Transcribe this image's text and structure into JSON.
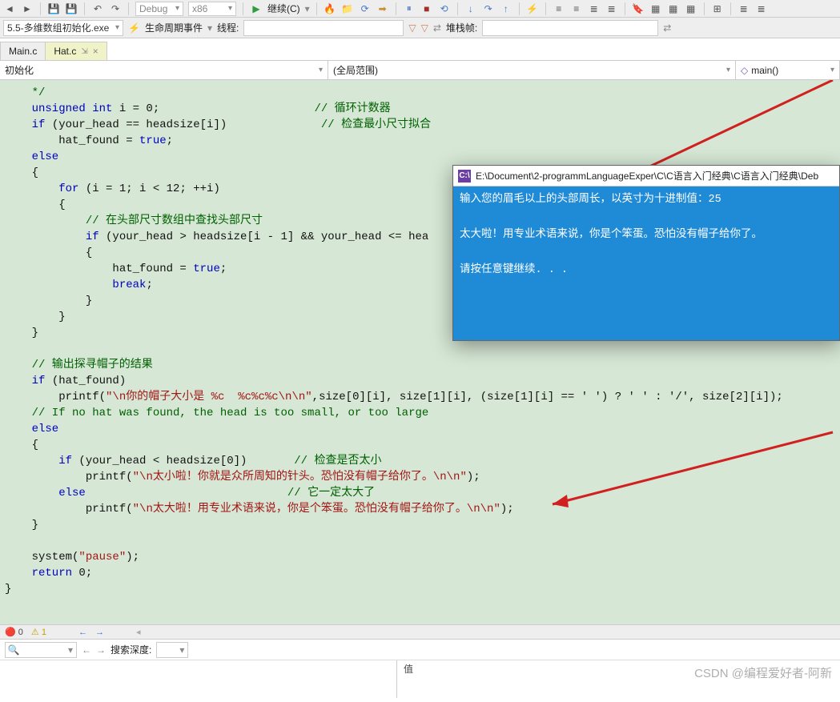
{
  "toolbar": {
    "config": "Debug",
    "platform": "x86",
    "continue_label": "继续(C)"
  },
  "secondbar": {
    "process_label": "5.5-多维数组初始化.exe",
    "lifecycle_label": "生命周期事件",
    "thread_label": "线程:",
    "stackframe_label": "堆栈帧:"
  },
  "tabs": {
    "t0": "Main.c",
    "t1": "Hat.c"
  },
  "scopes": {
    "left": "初始化",
    "mid": "(全局范围)",
    "right": "main()"
  },
  "code": {
    "l0": "    */",
    "l1a": "    unsigned int ",
    "l1b": "i = 0;",
    "l1c": "                       // 循环计数器",
    "l2a": "    if ",
    "l2b": "(your_head == headsize[i])",
    "l2c": "              // 检查最小尺寸拟合",
    "l3a": "        hat_found = ",
    "l3b": "true",
    "l3c": ";",
    "l4": "    else",
    "l5": "    {",
    "l6a": "        for ",
    "l6b": "(i = 1; i < 12; ++i)",
    "l7": "        {",
    "l8": "            // 在头部尺寸数组中查找头部尺寸",
    "l9a": "            if ",
    "l9b": "(your_head > headsize[i - 1] && your_head <= hea",
    "l10": "            {",
    "l11a": "                hat_found = ",
    "l11b": "true",
    "l11c": ";",
    "l12a": "                break",
    "l12b": ";",
    "l13": "            }",
    "l14": "        }",
    "l15": "    }",
    "blank1": "",
    "l16": "    // 输出探寻帽子的结果",
    "l17a": "    if ",
    "l17b": "(hat_found)",
    "l18a": "        printf(",
    "l18b": "\"\\n你的帽子大小是 %c  %c%c%c\\n\\n\"",
    "l18c": ",size[0][i], size[1][i], (size[1][i] == ' ') ? ' ' : '/', size[2][i]);",
    "l19": "    // If no hat was found, the head is too small, or too large",
    "l20": "    else",
    "l21": "    {",
    "l22a": "        if ",
    "l22b": "(your_head < headsize[0])",
    "l22c": "       // 检查是否太小",
    "l23a": "            printf(",
    "l23b": "\"\\n太小啦！你就是众所周知的针头。恐怕没有帽子给你了。\\n\\n\"",
    "l23c": ");",
    "l24a": "        else",
    "l24b": "                              // 它一定太大了",
    "l25a": "            printf(",
    "l25b": "\"\\n太大啦！用专业术语来说，你是个笨蛋。恐怕没有帽子给你了。\\n\\n\"",
    "l25c": ");",
    "l26": "    }",
    "blank2": "",
    "l27a": "    system(",
    "l27b": "\"pause\"",
    "l27c": ");",
    "l28a": "    return ",
    "l28b": "0;",
    "l29": "}"
  },
  "console": {
    "title": "E:\\Document\\2-programmLanguageExper\\C\\C语言入门经典\\C语言入门经典\\Deb",
    "line1": "输入您的眉毛以上的头部周长，以英寸为十进制值：25",
    "line2": "太大啦！用专业术语来说，你是个笨蛋。恐怕没有帽子给你了。",
    "line3": "请按任意键继续. . ."
  },
  "status": {
    "err": "0",
    "warn": "1"
  },
  "bottom": {
    "search_depth_label": "搜索深度:",
    "col_label": "值"
  },
  "watermark": "CSDN @编程爱好者-阿新"
}
